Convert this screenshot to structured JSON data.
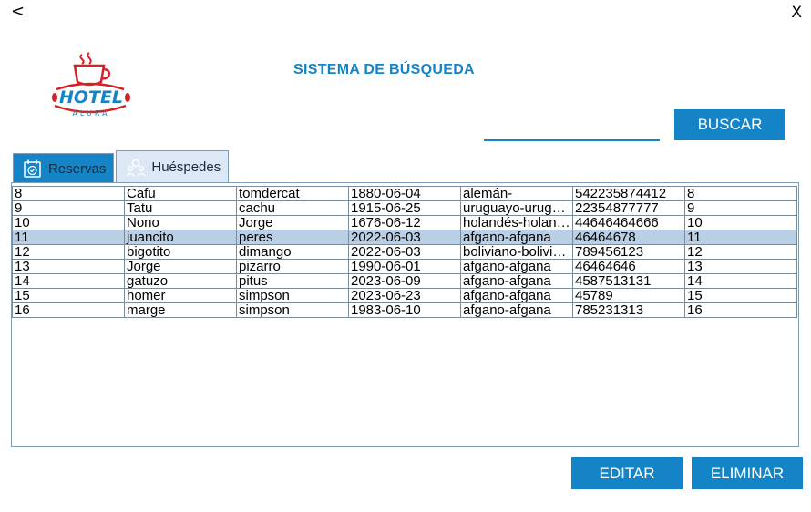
{
  "window": {
    "back_label": "<",
    "close_label": "X"
  },
  "logo": {
    "brand": "HOTEL",
    "sub": "ALURA",
    "icon": "coffee-cup-icon"
  },
  "header": {
    "title": "SISTEMA DE BÚSQUEDA"
  },
  "search": {
    "value": "",
    "button_label": "BUSCAR"
  },
  "tabs": [
    {
      "label": "Reservas",
      "icon": "calendar-check-icon",
      "active": false
    },
    {
      "label": "Huéspedes",
      "icon": "people-search-icon",
      "active": true
    }
  ],
  "table": {
    "selected_row_index": 3,
    "rows": [
      [
        "8",
        "Cafu",
        "tomdercat",
        "1880-06-04",
        "alemán-",
        "542235874412",
        "8"
      ],
      [
        "9",
        "Tatu",
        "cachu",
        "1915-06-25",
        "uruguayo-uruguaya",
        "22354877777",
        "9"
      ],
      [
        "10",
        "Nono",
        "Jorge",
        "1676-06-12",
        "holandés-holandesa",
        "44646464666",
        "10"
      ],
      [
        "11",
        "juancito",
        "peres",
        "2022-06-03",
        "afgano-afgana",
        "46464678",
        "11"
      ],
      [
        "12",
        "bigotito",
        "dimango",
        "2022-06-03",
        "boliviano-boliviana",
        "789456123",
        "12"
      ],
      [
        "13",
        "Jorge",
        "pizarro",
        "1990-06-01",
        "afgano-afgana",
        "46464646",
        "13"
      ],
      [
        "14",
        "gatuzo",
        "pitus",
        "2023-06-09",
        "afgano-afgana",
        "4587513131",
        "14"
      ],
      [
        "15",
        "homer",
        "simpson",
        "2023-06-23",
        "afgano-afgana",
        "45789",
        "15"
      ],
      [
        "16",
        "marge",
        "simpson",
        "1983-06-10",
        "afgano-afgana",
        "785231313",
        "16"
      ]
    ]
  },
  "actions": {
    "edit_label": "EDITAR",
    "delete_label": "ELIMINAR"
  },
  "colors": {
    "accent": "#1584c6",
    "selected_row": "#b8cfe5",
    "logo_red": "#d3222a"
  }
}
